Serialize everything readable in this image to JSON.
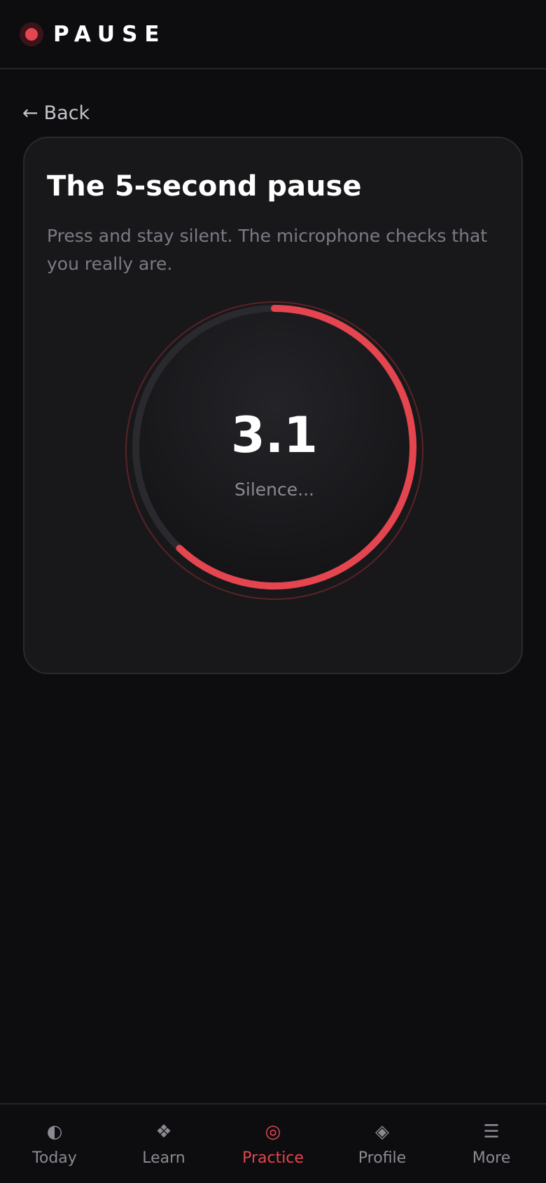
{
  "app": {
    "brand": "PAUSE"
  },
  "nav": {
    "back_label": "Back",
    "back_arrow": "←"
  },
  "exercise": {
    "title": "The 5-second pause",
    "description": "Press and stay silent. The microphone checks that you really are.",
    "timer_value": "3.1",
    "timer_status": "Silence...",
    "duration_seconds": 5,
    "progress_fraction": 0.62
  },
  "colors": {
    "accent": "#e5454f",
    "background": "#0d0d0f",
    "card": "#18181b",
    "muted_text": "#7b7b85",
    "ring_track": "#2a2a2e"
  },
  "bottom_nav": [
    {
      "label": "Today",
      "icon": "◐",
      "icon_name": "half-circle-icon",
      "active": false
    },
    {
      "label": "Learn",
      "icon": "❖",
      "icon_name": "diamond-cluster-icon",
      "active": false
    },
    {
      "label": "Practice",
      "icon": "◎",
      "icon_name": "target-icon",
      "active": true
    },
    {
      "label": "Profile",
      "icon": "◈",
      "icon_name": "diamond-icon",
      "active": false
    },
    {
      "label": "More",
      "icon": "☰",
      "icon_name": "menu-icon",
      "active": false
    }
  ]
}
